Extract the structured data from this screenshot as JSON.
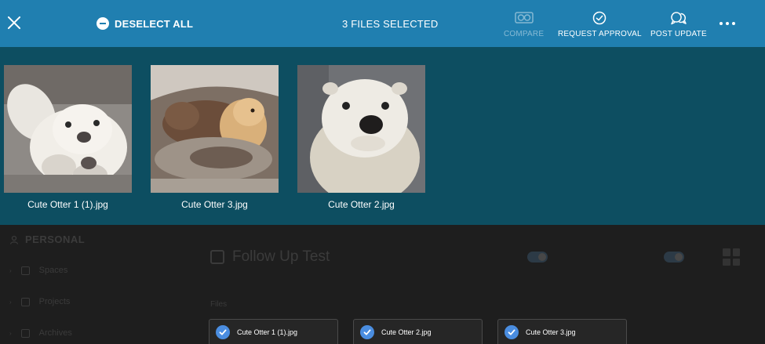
{
  "toolbar": {
    "deselect_label": "DESELECT ALL",
    "selected_count": "3 FILES SELECTED",
    "actions": {
      "compare": "COMPARE",
      "request_approval": "REQUEST APPROVAL",
      "post_update": "POST UPDATE"
    }
  },
  "selected_files": [
    {
      "name": "Cute Otter 1 (1).jpg"
    },
    {
      "name": "Cute Otter 3.jpg"
    },
    {
      "name": "Cute Otter 2.jpg"
    }
  ],
  "background": {
    "section": "PERSONAL",
    "sidebar": [
      "Spaces",
      "Projects",
      "Archives"
    ],
    "title": "Follow Up Test",
    "files_label": "Files",
    "file_cards": [
      {
        "name": "Cute Otter 1 (1).jpg"
      },
      {
        "name": "Cute Otter 2.jpg"
      },
      {
        "name": "Cute Otter 3.jpg"
      }
    ]
  },
  "colors": {
    "toolbar": "#207fb0",
    "tray": "#0d4e61",
    "background": "#1e1e1e",
    "annotation": "#e02020",
    "check": "#4a8de0"
  },
  "icons": {
    "close": "close-icon",
    "deselect": "minus-circle-icon",
    "compare": "compare-icon",
    "request_approval": "check-circle-icon",
    "post_update": "chat-bubbles-icon",
    "more": "more-horizontal-icon"
  }
}
